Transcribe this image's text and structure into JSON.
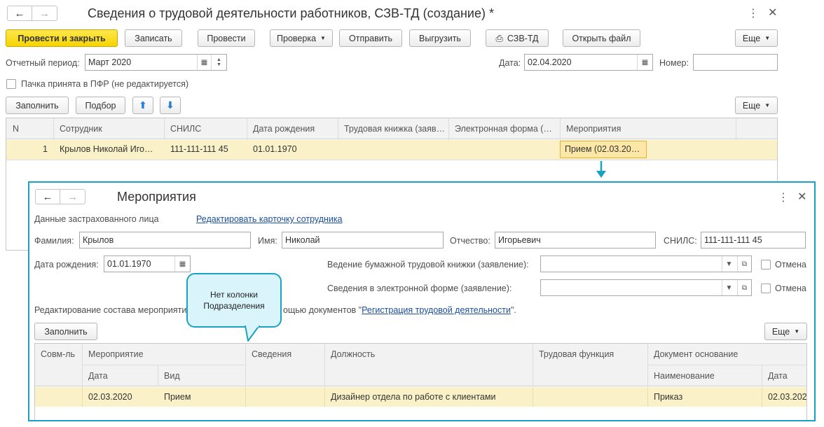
{
  "main_window": {
    "title": "Сведения о трудовой деятельности работников, СЗВ-ТД (создание) *",
    "toolbar": {
      "post_close": "Провести и закрыть",
      "save": "Записать",
      "post": "Провести",
      "check": "Проверка",
      "send": "Отправить",
      "export": "Выгрузить",
      "print_szv": "СЗВ-ТД",
      "open_file": "Открыть файл",
      "more": "Еще"
    },
    "period_label": "Отчетный период:",
    "period_value": "Март 2020",
    "date_label": "Дата:",
    "date_value": "02.04.2020",
    "number_label": "Номер:",
    "number_value": "",
    "pfr_checkbox_label": "Пачка принята в ПФР (не редактируется)",
    "table_toolbar": {
      "fill": "Заполнить",
      "select": "Подбор",
      "more": "Еще"
    },
    "columns": [
      "N",
      "Сотрудник",
      "СНИЛС",
      "Дата рождения",
      "Трудовая книжка (заяв…",
      "Электронная форма (…",
      "Мероприятия"
    ],
    "rows": [
      {
        "n": "1",
        "employee": "Крылов Николай Иго…",
        "snils": "111-111-111 45",
        "birth": "01.01.1970",
        "book": "",
        "eform": "",
        "events": "Прием (02.03.20…"
      }
    ]
  },
  "sub_window": {
    "title": "Мероприятия",
    "insured_label": "Данные застрахованного лица",
    "edit_card_link": "Редактировать карточку сотрудника",
    "surname_label": "Фамилия:",
    "surname_value": "Крылов",
    "name_label": "Имя:",
    "name_value": "Николай",
    "patronymic_label": "Отчество:",
    "patronymic_value": "Игорьевич",
    "snils_label": "СНИЛС:",
    "snils_value": "111-111-111 45",
    "birth_label": "Дата рождения:",
    "birth_value": "01.01.1970",
    "paper_book_label": "Ведение бумажной трудовой книжки (заявление):",
    "eform_label": "Сведения в электронной форме (заявление):",
    "cancel_label": "Отмена",
    "edit_text_start": "Редактирование состава мероприяти",
    "edit_text_mid": "ощью документов \"",
    "edit_text_link": "Регистрация трудовой деятельности",
    "edit_text_end": "\".",
    "fill": "Заполнить",
    "more": "Еще",
    "headers": {
      "combo": "Совм-ль",
      "event": "Мероприятие",
      "date": "Дата",
      "kind": "Вид",
      "info": "Сведения",
      "position": "Должность",
      "labor_function": "Трудовая функция",
      "doc_basis": "Документ основание",
      "doc_name": "Наименование",
      "doc_date": "Дата"
    },
    "row": {
      "date": "02.03.2020",
      "kind": "Прием",
      "position": "Дизайнер отдела по работе с клиентами",
      "doc_name": "Приказ",
      "doc_date": "02.03.202"
    }
  },
  "callout": {
    "text_line1": "Нет колонки",
    "text_line2": "Подразделения"
  }
}
